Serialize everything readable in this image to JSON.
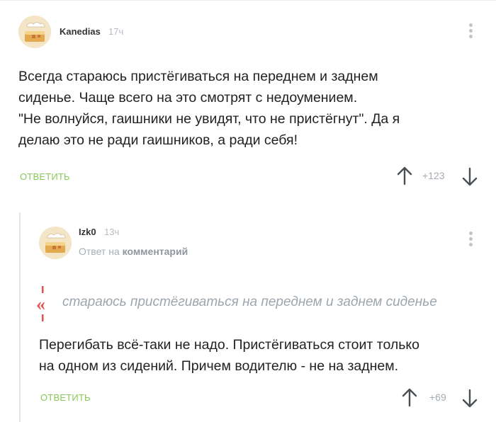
{
  "comments": [
    {
      "username": "Kanedias",
      "time": "17ч",
      "text_lines": [
        "Всегда стараюсь пристёгиваться на переднем и заднем",
        "сиденье. Чаще всего на это смотрят с недоумением.",
        "\"Не волнуйся, гаишники не увидят, что не пристёгнут\". Да я",
        "делаю это не ради гаишников, а ради себя!"
      ],
      "reply_label": "ОТВЕТИТЬ",
      "rating": "+123"
    },
    {
      "username": "Izk0",
      "time": "13ч",
      "reply_to_prefix": "Ответ на",
      "reply_to_link": "комментарий",
      "quote": "стараюсь пристёгиваться на переднем и заднем сиденье",
      "text_lines": [
        "Перегибать всё-таки не надо. Пристёгиваться стоит только",
        "на одном из сидений. Причем водителю - не на заднем."
      ],
      "reply_label": "ОТВЕТИТЬ",
      "rating": "+69"
    }
  ],
  "colors": {
    "accent_green": "#8ac858",
    "muted_text": "#a4abb2",
    "quote_mark_red": "#e2534e"
  },
  "icons": [
    "avatar-cake-icon",
    "more-dots-icon",
    "upvote-arrow-icon",
    "downvote-arrow-icon",
    "quote-mark-icon"
  ]
}
